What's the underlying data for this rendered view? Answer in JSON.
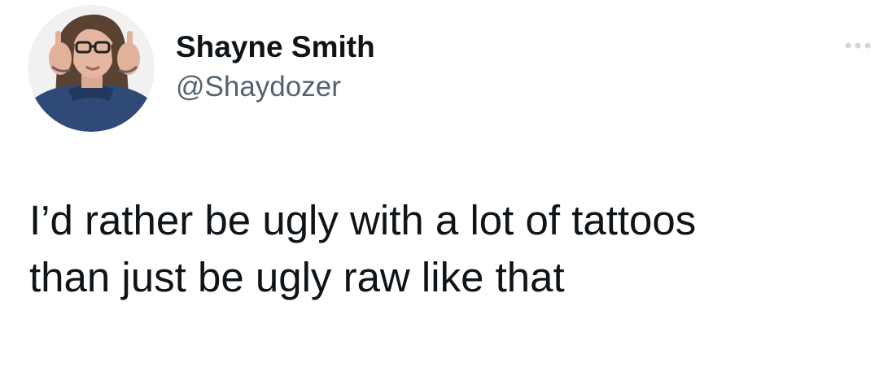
{
  "tweet": {
    "author": {
      "display_name": "Shayne Smith",
      "handle": "@Shaydozer",
      "avatar_icon": "profile-photo"
    },
    "more_icon": "more-options-icon",
    "text_lines": [
      "I’d rather be ugly with a lot of tattoos",
      "than just be ugly raw like that"
    ]
  },
  "colors": {
    "text_primary": "#0f1419",
    "text_secondary": "#536471",
    "background": "#ffffff",
    "more_icon": "#cfd9de"
  }
}
